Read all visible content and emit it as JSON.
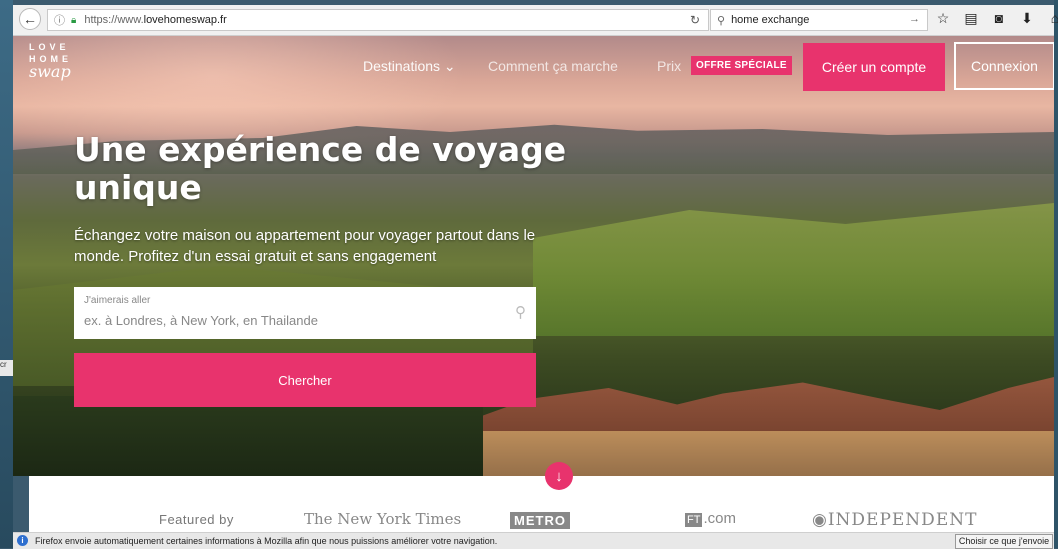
{
  "browser": {
    "url_prefix": "https://www.",
    "url_domain": "lovehomeswap.fr",
    "search_query": "home exchange"
  },
  "site": {
    "logo_line1": "LOVE",
    "logo_line2": "HOME",
    "logo_line3": "swap",
    "nav": {
      "destinations": "Destinations ⌄",
      "how_it_works": "Comment ça marche",
      "price": "Prix",
      "promo_badge": "OFFRE SPÉCIALE",
      "create_account": "Créer un compte",
      "login": "Connexion"
    },
    "hero": {
      "headline": "Une expérience de voyage unique",
      "subline": "Échangez votre maison ou appartement pour voyager partout dans le monde. Profitez d'un essai gratuit et sans engagement",
      "search_label": "J'aimerais aller",
      "search_placeholder": "ex. à Londres, à New York, en Thailande",
      "search_button": "Chercher"
    },
    "featured": {
      "label": "Featured by",
      "logos": [
        "The New York Times",
        "METRO",
        "FT",
        ".com",
        "◉INDEPENDENT"
      ]
    }
  },
  "notification": {
    "message": "Firefox envoie automatiquement certaines informations à Mozilla afin que nous puissions améliorer votre navigation.",
    "button": "Choisir ce que j'envoie"
  },
  "colors": {
    "accent": "#e8336d"
  },
  "icons": [
    "back-arrow-icon",
    "info-icon",
    "lock-icon",
    "reload-icon",
    "search-icon",
    "forward-arrow-icon",
    "star-icon",
    "reading-list-icon",
    "pocket-icon",
    "download-icon",
    "home-icon",
    "chevron-down-icon",
    "arrow-down-icon"
  ]
}
